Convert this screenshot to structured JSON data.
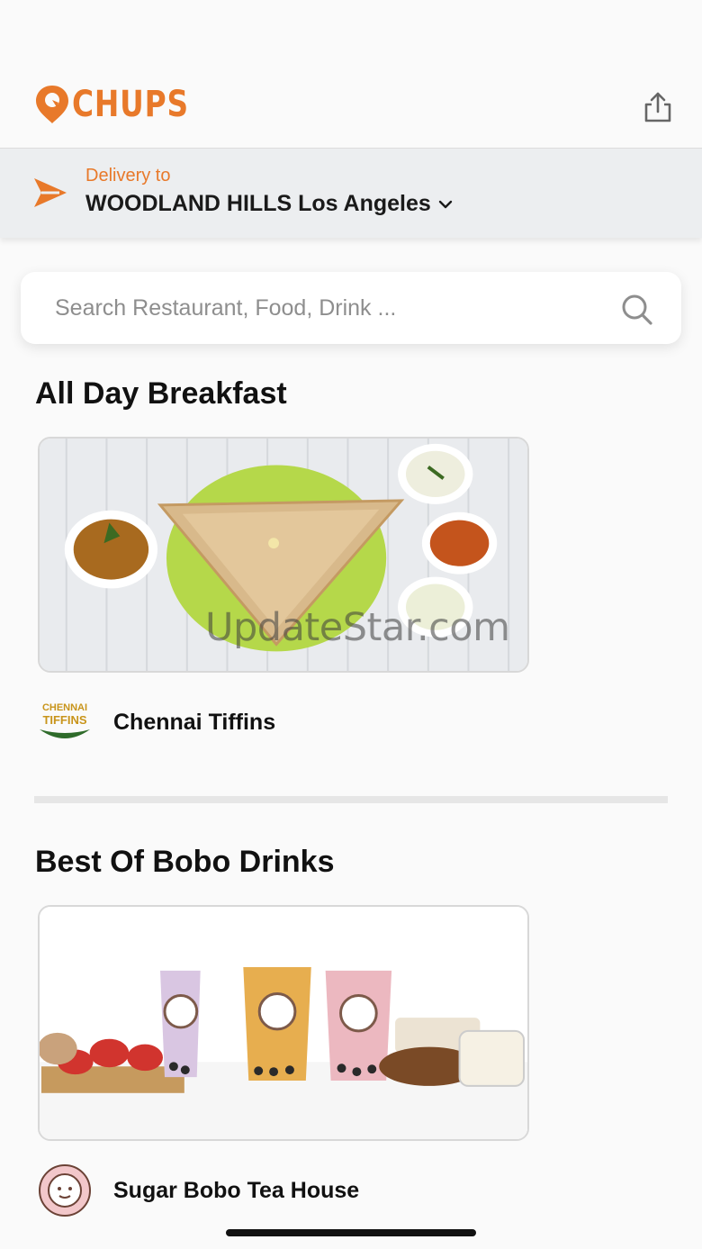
{
  "header": {
    "logo_text": "CHUPS",
    "brand_color": "#e8792a",
    "share_icon": "share-icon"
  },
  "delivery": {
    "label": "Delivery to",
    "address": "WOODLAND HILLS Los Angeles",
    "icon": "send-arrow-icon"
  },
  "search": {
    "placeholder": "Search Restaurant, Food, Drink ...",
    "value": "",
    "icon": "search-icon"
  },
  "sections": [
    {
      "title": "All Day Breakfast",
      "restaurant": {
        "name": "Chennai Tiffins",
        "logo_text_1": "CHENNAI",
        "logo_text_2": "TIFFINS"
      }
    },
    {
      "title": "Best Of Bobo Drinks",
      "restaurant": {
        "name": "Sugar Bobo Tea House",
        "logo_text": "SUGAR BOBO TEA HOUSE"
      }
    }
  ],
  "watermark": "UpdateStar.com"
}
